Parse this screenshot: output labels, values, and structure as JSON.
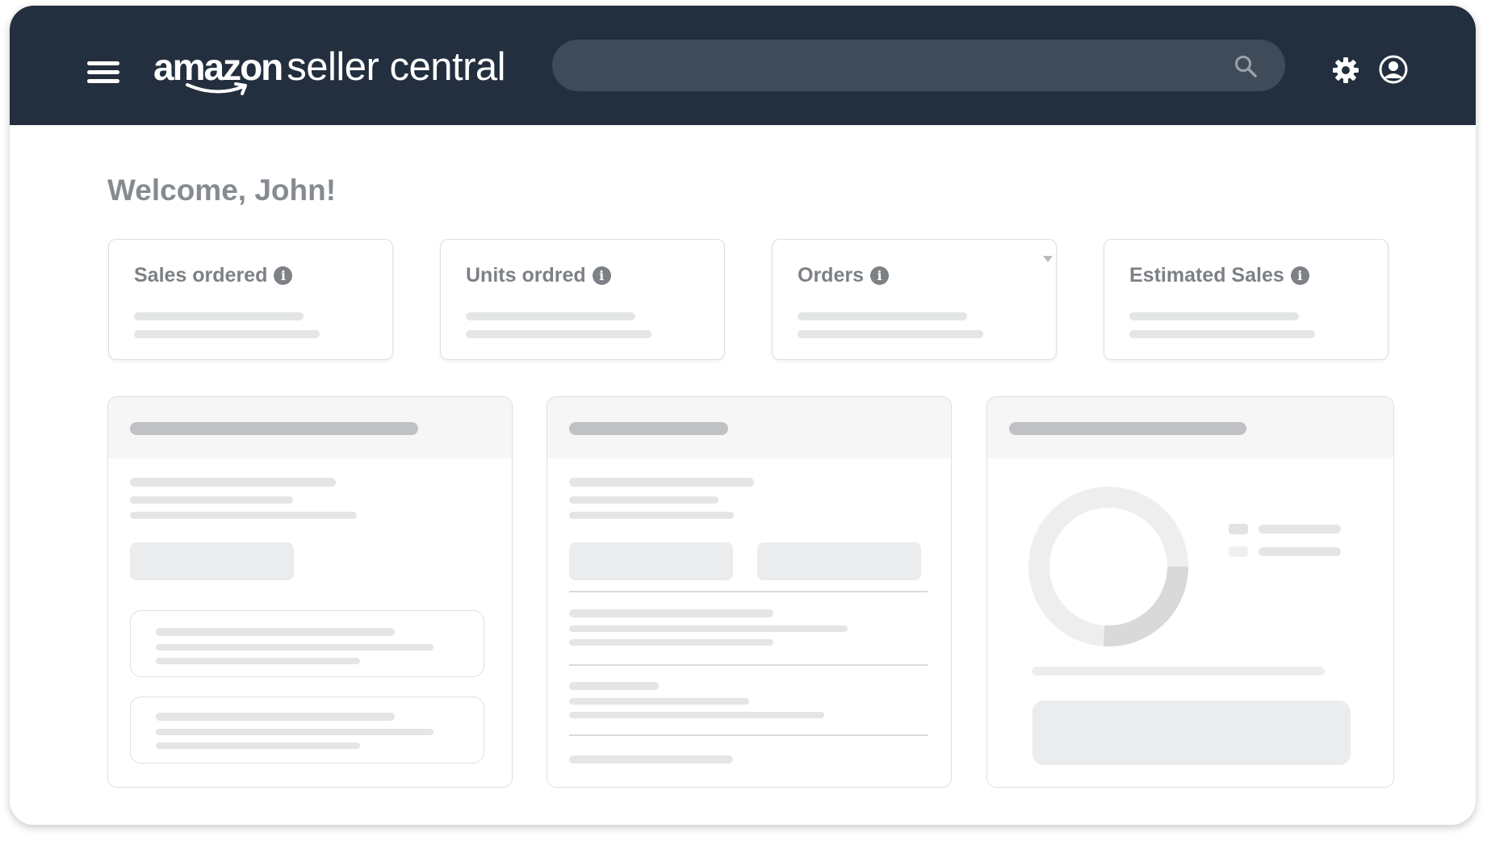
{
  "app": {
    "brand": "amazon",
    "product": "seller central"
  },
  "header": {
    "menu_icon": "hamburger-menu-icon",
    "search": {
      "placeholder": "",
      "icon": "search-icon"
    },
    "settings_icon": "gear-icon",
    "account_icon": "user-circle-icon"
  },
  "welcome": "Welcome, John!",
  "metrics": [
    {
      "label": "Sales ordered",
      "icon": "info-icon"
    },
    {
      "label": "Units ordred",
      "icon": "info-icon"
    },
    {
      "label": "Orders",
      "icon": "info-icon"
    },
    {
      "label": "Estimated Sales",
      "icon": "info-icon"
    }
  ],
  "info_glyph": "i",
  "colors": {
    "topbar": "#232f3e",
    "search_bg": "#3f4b59",
    "heading_text": "#878b91",
    "skeleton": "#e4e5e6",
    "skeleton_dark": "#bfc1c4",
    "donut_track": "#eeeeef",
    "donut_segment": "#d9d9da"
  },
  "donut": {
    "segment_fraction": 0.26
  }
}
